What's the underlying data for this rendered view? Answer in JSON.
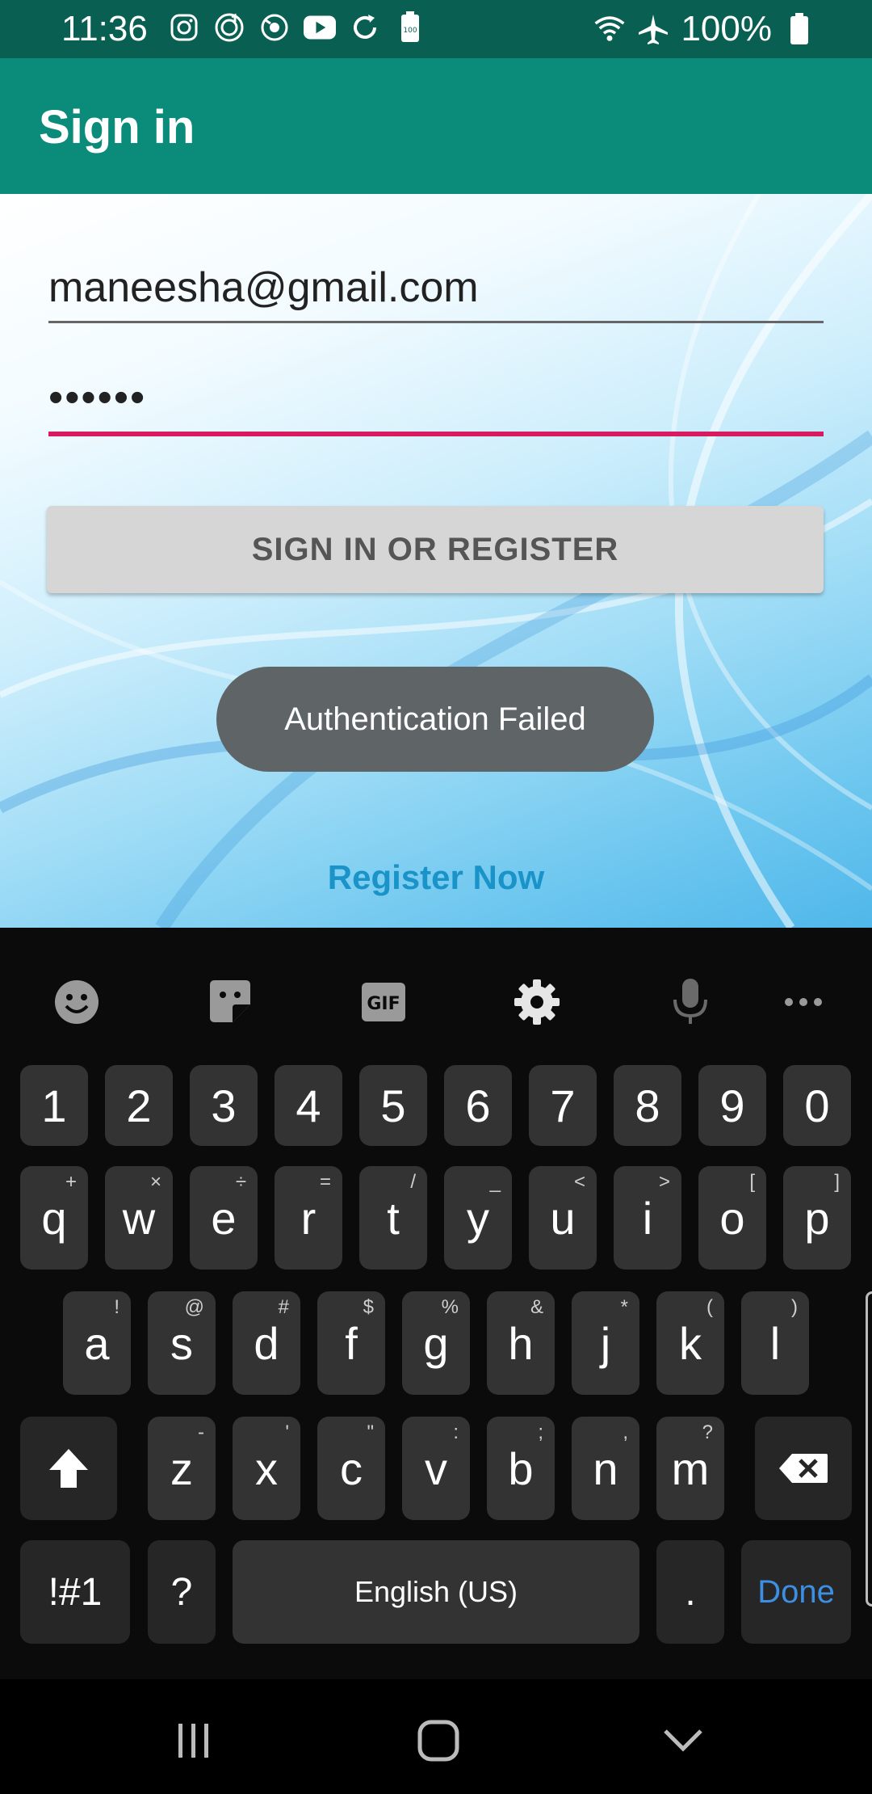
{
  "status_bar": {
    "time": "11:36",
    "battery_percent": "100%",
    "icons_left": [
      "instagram-icon",
      "music-icon",
      "sync-icon",
      "youtube-icon",
      "refresh-icon",
      "battery-saver-icon"
    ],
    "icons_right": [
      "wifi-icon",
      "airplane-mode-icon",
      "battery-icon"
    ]
  },
  "app_bar": {
    "title": "Sign in"
  },
  "form": {
    "email_value": "maneesha@gmail.com",
    "password_value": "••••••",
    "submit_label": "SIGN IN OR REGISTER"
  },
  "toast": {
    "message": "Authentication Failed"
  },
  "register_link": "Register Now",
  "keyboard": {
    "toolbar": [
      "emoji-icon",
      "sticker-icon",
      "gif-icon",
      "settings-icon",
      "microphone-icon",
      "more-icon"
    ],
    "number_row": [
      "1",
      "2",
      "3",
      "4",
      "5",
      "6",
      "7",
      "8",
      "9",
      "0"
    ],
    "row1": [
      {
        "k": "q",
        "s": "+"
      },
      {
        "k": "w",
        "s": "×"
      },
      {
        "k": "e",
        "s": "÷"
      },
      {
        "k": "r",
        "s": "="
      },
      {
        "k": "t",
        "s": "/"
      },
      {
        "k": "y",
        "s": "_"
      },
      {
        "k": "u",
        "s": "<"
      },
      {
        "k": "i",
        "s": ">"
      },
      {
        "k": "o",
        "s": "["
      },
      {
        "k": "p",
        "s": "]"
      }
    ],
    "row2": [
      {
        "k": "a",
        "s": "!"
      },
      {
        "k": "s",
        "s": "@"
      },
      {
        "k": "d",
        "s": "#"
      },
      {
        "k": "f",
        "s": "$"
      },
      {
        "k": "g",
        "s": "%"
      },
      {
        "k": "h",
        "s": "&"
      },
      {
        "k": "j",
        "s": "*"
      },
      {
        "k": "k",
        "s": "("
      },
      {
        "k": "l",
        "s": ")"
      }
    ],
    "row3": [
      {
        "k": "z",
        "s": "-"
      },
      {
        "k": "x",
        "s": "'"
      },
      {
        "k": "c",
        "s": "\""
      },
      {
        "k": "v",
        "s": ":"
      },
      {
        "k": "b",
        "s": ";"
      },
      {
        "k": "n",
        "s": ","
      },
      {
        "k": "m",
        "s": "?"
      }
    ],
    "symbols_label": "!#1",
    "question_label": "?",
    "space_label": "English (US)",
    "period_label": ".",
    "done_label": "Done"
  },
  "nav_bar": [
    "recent-apps-icon",
    "home-icon",
    "back-icon"
  ],
  "colors": {
    "status_bar": "#0a5f53",
    "app_bar": "#0b8b7a",
    "accent_underline": "#d81b60",
    "link": "#1a93c8",
    "done": "#3d8fe4"
  }
}
